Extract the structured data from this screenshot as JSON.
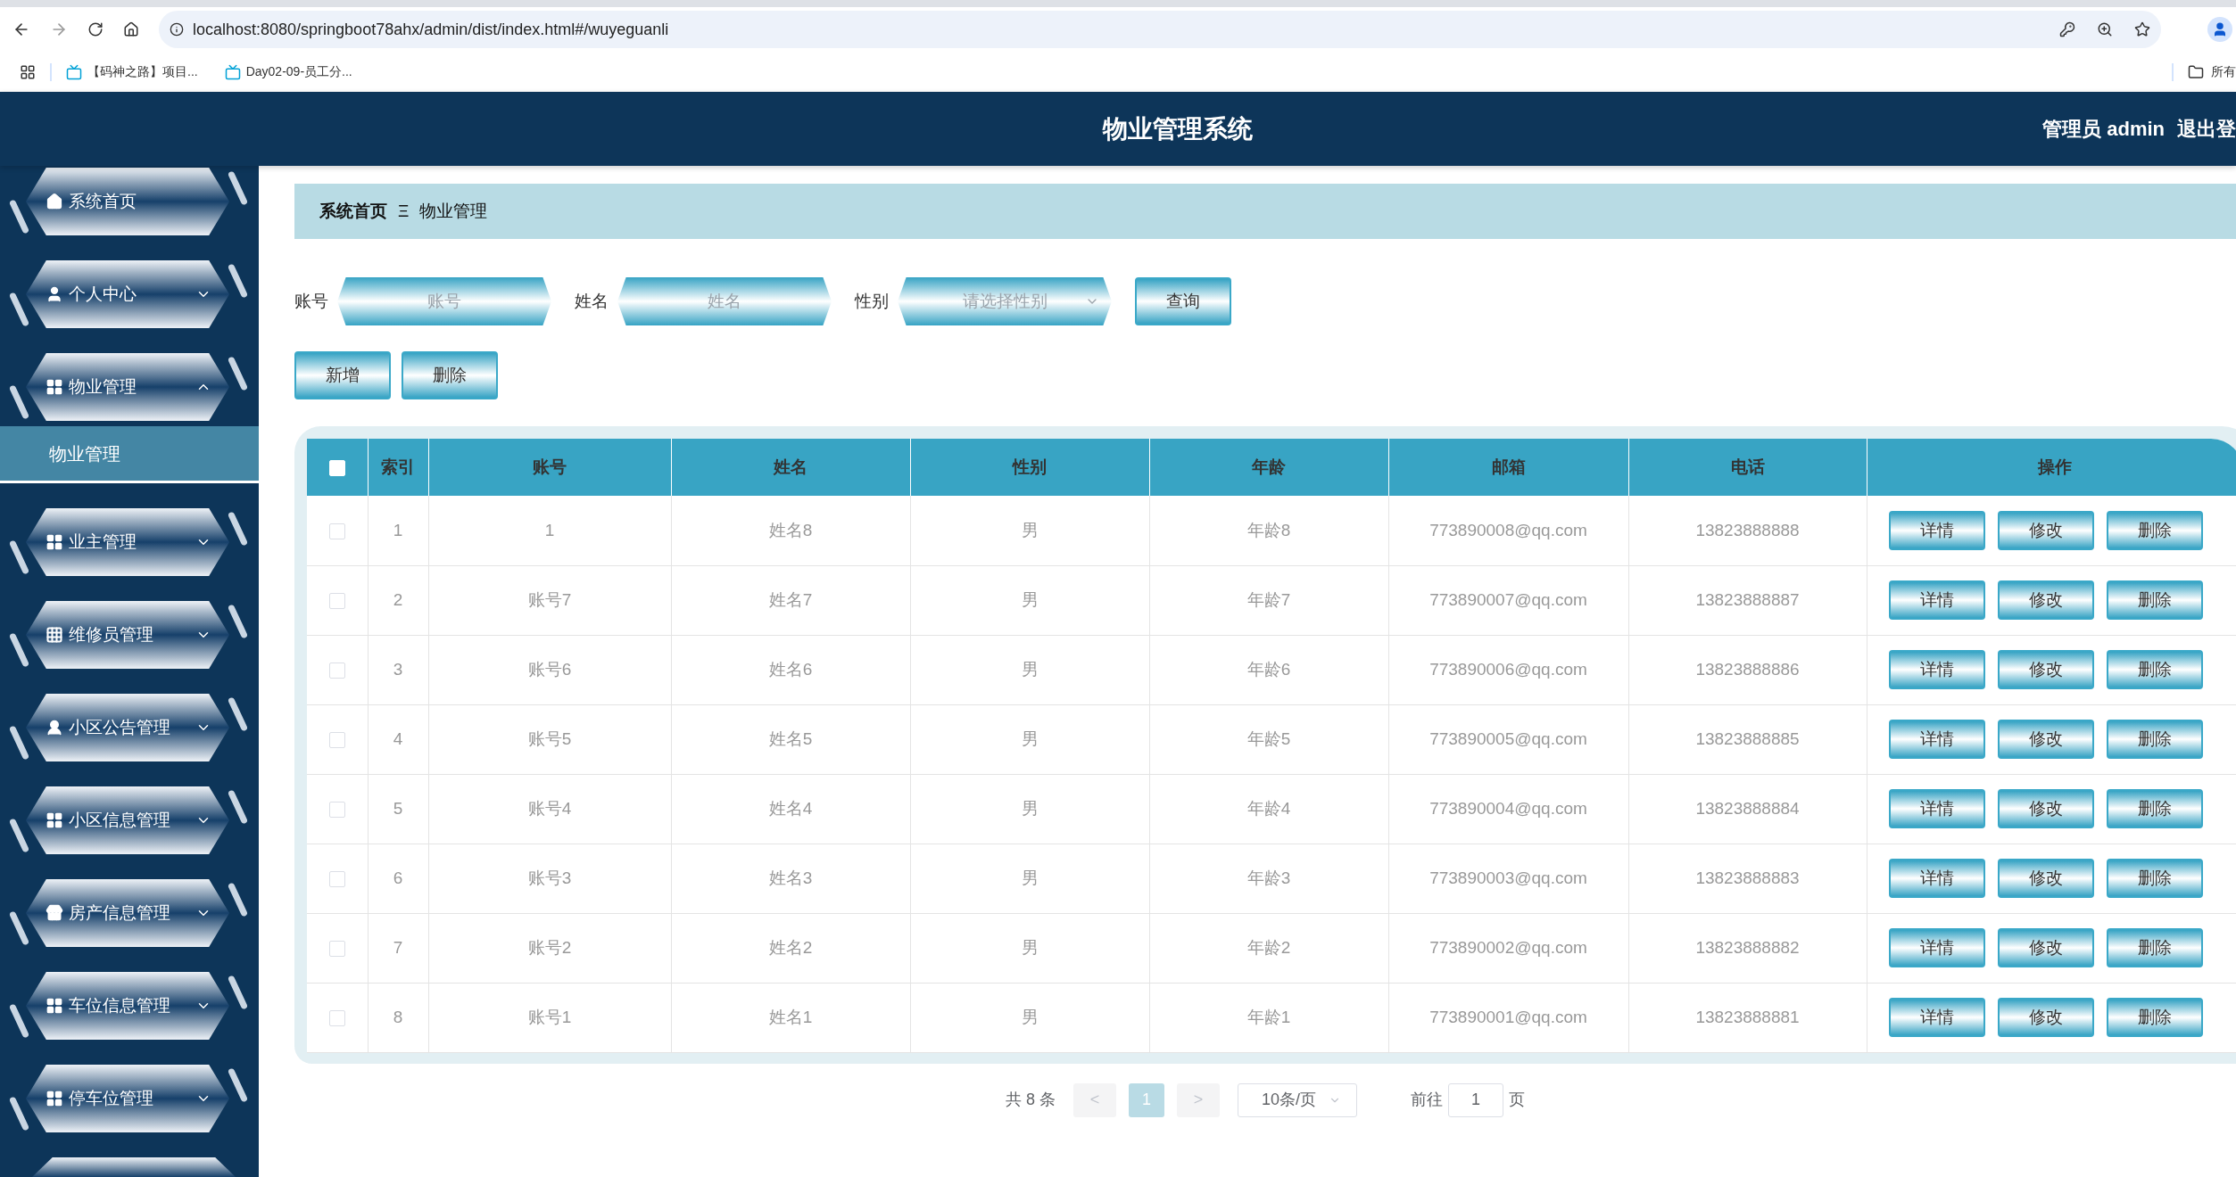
{
  "browser": {
    "url": "localhost:8080/springboot78ahx/admin/dist/index.html#/wuyeguanli",
    "bookmarks": [
      "【码神之路】项目...",
      "Day02-09-员工分..."
    ],
    "bookmark_folder": "所有"
  },
  "header": {
    "title": "物业管理系统",
    "user": "管理员 admin",
    "logout": "退出登"
  },
  "sidebar": {
    "items": [
      {
        "label": "系统首页",
        "kind": "home"
      },
      {
        "label": "个人中心",
        "kind": "user",
        "expanded": false
      },
      {
        "label": "物业管理",
        "kind": "grid",
        "expanded": true,
        "children": [
          {
            "label": "物业管理",
            "selected": true
          }
        ]
      },
      {
        "label": "业主管理",
        "kind": "grid",
        "expanded": false
      },
      {
        "label": "维修员管理",
        "kind": "grid9",
        "expanded": false
      },
      {
        "label": "小区公告管理",
        "kind": "person",
        "expanded": false
      },
      {
        "label": "小区信息管理",
        "kind": "grid",
        "expanded": false
      },
      {
        "label": "房产信息管理",
        "kind": "store",
        "expanded": false
      },
      {
        "label": "车位信息管理",
        "kind": "grid",
        "expanded": false
      },
      {
        "label": "停车位管理",
        "kind": "grid",
        "expanded": false
      }
    ]
  },
  "breadcrumb": {
    "home": "系统首页",
    "separator": "Ξ",
    "current": "物业管理"
  },
  "filters": [
    {
      "label": "账号",
      "placeholder": "账号",
      "kind": "input"
    },
    {
      "label": "姓名",
      "placeholder": "姓名",
      "kind": "input"
    },
    {
      "label": "性别",
      "placeholder": "请选择性别",
      "kind": "select"
    }
  ],
  "search_button": "查询",
  "actions": [
    "新增",
    "删除"
  ],
  "table": {
    "select_all_checked": false,
    "columns": [
      "索引",
      "账号",
      "姓名",
      "性别",
      "年龄",
      "邮箱",
      "电话",
      "操作"
    ],
    "rows": [
      {
        "checked": false,
        "cells": [
          "1",
          "1",
          "姓名8",
          "男",
          "年龄8",
          "773890008@qq.com",
          "13823888888"
        ],
        "buttons": [
          "详情",
          "修改",
          "删除"
        ]
      },
      {
        "checked": false,
        "cells": [
          "2",
          "账号7",
          "姓名7",
          "男",
          "年龄7",
          "773890007@qq.com",
          "13823888887"
        ],
        "buttons": [
          "详情",
          "修改",
          "删除"
        ]
      },
      {
        "checked": false,
        "cells": [
          "3",
          "账号6",
          "姓名6",
          "男",
          "年龄6",
          "773890006@qq.com",
          "13823888886"
        ],
        "buttons": [
          "详情",
          "修改",
          "删除"
        ]
      },
      {
        "checked": false,
        "cells": [
          "4",
          "账号5",
          "姓名5",
          "男",
          "年龄5",
          "773890005@qq.com",
          "13823888885"
        ],
        "buttons": [
          "详情",
          "修改",
          "删除"
        ]
      },
      {
        "checked": false,
        "cells": [
          "5",
          "账号4",
          "姓名4",
          "男",
          "年龄4",
          "773890004@qq.com",
          "13823888884"
        ],
        "buttons": [
          "详情",
          "修改",
          "删除"
        ]
      },
      {
        "checked": false,
        "cells": [
          "6",
          "账号3",
          "姓名3",
          "男",
          "年龄3",
          "773890003@qq.com",
          "13823888883"
        ],
        "buttons": [
          "详情",
          "修改",
          "删除"
        ]
      },
      {
        "checked": false,
        "cells": [
          "7",
          "账号2",
          "姓名2",
          "男",
          "年龄2",
          "773890002@qq.com",
          "13823888882"
        ],
        "buttons": [
          "详情",
          "修改",
          "删除"
        ]
      },
      {
        "checked": false,
        "cells": [
          "8",
          "账号1",
          "姓名1",
          "男",
          "年龄1",
          "773890001@qq.com",
          "13823888881"
        ],
        "buttons": [
          "详情",
          "修改",
          "删除"
        ]
      }
    ]
  },
  "pagination": {
    "total": "共 8 条",
    "prev": "<",
    "pages": [
      {
        "label": "1",
        "selected": true
      }
    ],
    "next": ">",
    "page_size": "10条/页",
    "goto_label": "前往",
    "goto_value": "1",
    "goto_suffix": "页"
  }
}
